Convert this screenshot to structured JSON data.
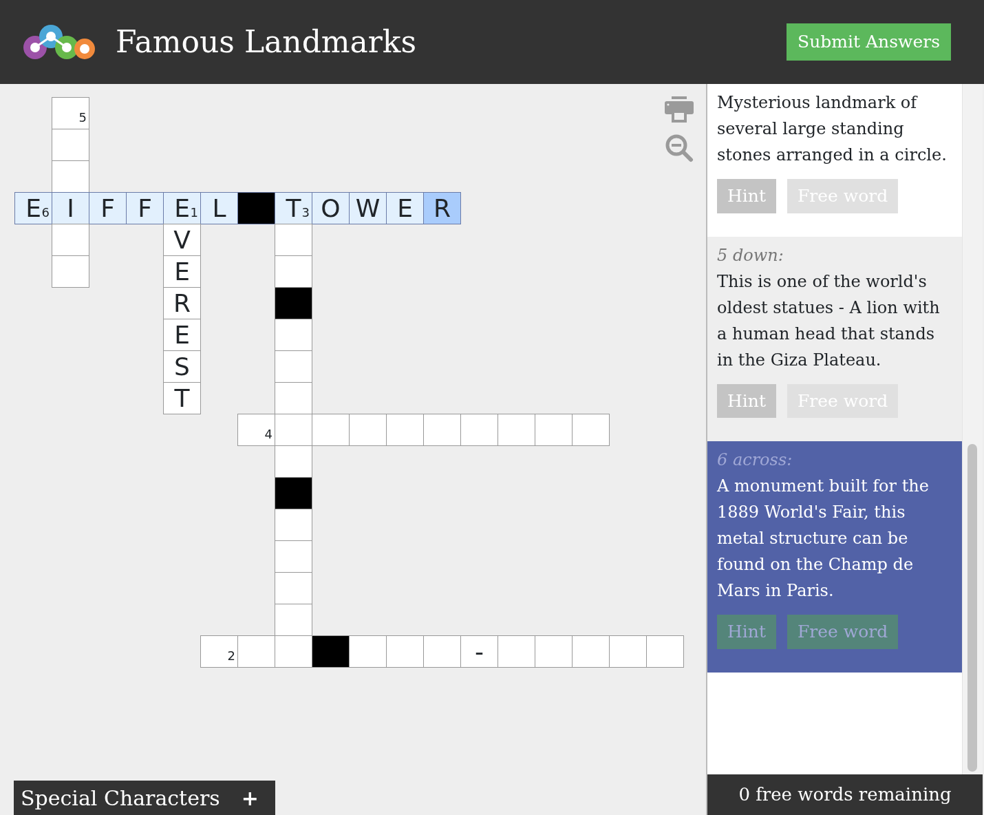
{
  "header": {
    "title": "Famous Landmarks",
    "submit_button": "Submit Answers"
  },
  "grid": [
    [
      {
        "kind": "none"
      },
      {
        "kind": "open",
        "number": "5",
        "highlighted": false,
        "selected": false
      }
    ],
    [
      {
        "kind": "none"
      },
      {
        "kind": "open",
        "highlighted": false,
        "selected": false
      }
    ],
    [
      {
        "kind": "none"
      },
      {
        "kind": "open",
        "highlighted": false,
        "selected": false
      }
    ],
    [
      {
        "kind": "open",
        "letter": "E",
        "number": "6",
        "highlighted": true,
        "selected": false
      },
      {
        "kind": "open",
        "letter": "I",
        "highlighted": true,
        "selected": false
      },
      {
        "kind": "open",
        "letter": "F",
        "highlighted": true,
        "selected": false
      },
      {
        "kind": "open",
        "letter": "F",
        "highlighted": true,
        "selected": false
      },
      {
        "kind": "open",
        "letter": "E",
        "number": "1",
        "highlighted": true,
        "selected": false
      },
      {
        "kind": "open",
        "letter": "L",
        "highlighted": true,
        "selected": false
      },
      {
        "kind": "block",
        "highlighted": true
      },
      {
        "kind": "open",
        "letter": "T",
        "number": "3",
        "highlighted": true,
        "selected": false
      },
      {
        "kind": "open",
        "letter": "O",
        "highlighted": true,
        "selected": false
      },
      {
        "kind": "open",
        "letter": "W",
        "highlighted": true,
        "selected": false
      },
      {
        "kind": "open",
        "letter": "E",
        "highlighted": true,
        "selected": false
      },
      {
        "kind": "open",
        "letter": "R",
        "highlighted": true,
        "selected": true
      }
    ],
    [
      {
        "kind": "none"
      },
      {
        "kind": "open",
        "highlighted": false,
        "selected": false
      },
      {
        "kind": "none"
      },
      {
        "kind": "none"
      },
      {
        "kind": "open",
        "letter": "V",
        "highlighted": false,
        "selected": false
      },
      {
        "kind": "none"
      },
      {
        "kind": "none"
      },
      {
        "kind": "open",
        "highlighted": false,
        "selected": false
      }
    ],
    [
      {
        "kind": "none"
      },
      {
        "kind": "open",
        "highlighted": false,
        "selected": false
      },
      {
        "kind": "none"
      },
      {
        "kind": "none"
      },
      {
        "kind": "open",
        "letter": "E",
        "highlighted": false,
        "selected": false
      },
      {
        "kind": "none"
      },
      {
        "kind": "none"
      },
      {
        "kind": "open",
        "highlighted": false,
        "selected": false
      }
    ],
    [
      {
        "kind": "none"
      },
      {
        "kind": "none"
      },
      {
        "kind": "none"
      },
      {
        "kind": "none"
      },
      {
        "kind": "open",
        "letter": "R",
        "highlighted": false,
        "selected": false
      },
      {
        "kind": "none"
      },
      {
        "kind": "none"
      },
      {
        "kind": "block",
        "highlighted": false
      }
    ],
    [
      {
        "kind": "none"
      },
      {
        "kind": "none"
      },
      {
        "kind": "none"
      },
      {
        "kind": "none"
      },
      {
        "kind": "open",
        "letter": "E",
        "highlighted": false,
        "selected": false
      },
      {
        "kind": "none"
      },
      {
        "kind": "none"
      },
      {
        "kind": "open",
        "highlighted": false,
        "selected": false
      }
    ],
    [
      {
        "kind": "none"
      },
      {
        "kind": "none"
      },
      {
        "kind": "none"
      },
      {
        "kind": "none"
      },
      {
        "kind": "open",
        "letter": "S",
        "highlighted": false,
        "selected": false
      },
      {
        "kind": "none"
      },
      {
        "kind": "none"
      },
      {
        "kind": "open",
        "highlighted": false,
        "selected": false
      }
    ],
    [
      {
        "kind": "none"
      },
      {
        "kind": "none"
      },
      {
        "kind": "none"
      },
      {
        "kind": "none"
      },
      {
        "kind": "open",
        "letter": "T",
        "highlighted": false,
        "selected": false
      },
      {
        "kind": "none"
      },
      {
        "kind": "none"
      },
      {
        "kind": "open",
        "highlighted": false,
        "selected": false
      }
    ],
    [
      {
        "kind": "none"
      },
      {
        "kind": "none"
      },
      {
        "kind": "none"
      },
      {
        "kind": "none"
      },
      {
        "kind": "none"
      },
      {
        "kind": "none"
      },
      {
        "kind": "open",
        "number": "4",
        "highlighted": false,
        "selected": false
      },
      {
        "kind": "open",
        "highlighted": false,
        "selected": false
      },
      {
        "kind": "open",
        "highlighted": false,
        "selected": false
      },
      {
        "kind": "open",
        "highlighted": false,
        "selected": false
      },
      {
        "kind": "open",
        "highlighted": false,
        "selected": false
      },
      {
        "kind": "open",
        "highlighted": false,
        "selected": false
      },
      {
        "kind": "open",
        "highlighted": false,
        "selected": false
      },
      {
        "kind": "open",
        "highlighted": false,
        "selected": false
      },
      {
        "kind": "open",
        "highlighted": false,
        "selected": false
      },
      {
        "kind": "open",
        "highlighted": false,
        "selected": false
      }
    ],
    [
      {
        "kind": "none"
      },
      {
        "kind": "none"
      },
      {
        "kind": "none"
      },
      {
        "kind": "none"
      },
      {
        "kind": "none"
      },
      {
        "kind": "none"
      },
      {
        "kind": "none"
      },
      {
        "kind": "open",
        "highlighted": false,
        "selected": false
      }
    ],
    [
      {
        "kind": "none"
      },
      {
        "kind": "none"
      },
      {
        "kind": "none"
      },
      {
        "kind": "none"
      },
      {
        "kind": "none"
      },
      {
        "kind": "none"
      },
      {
        "kind": "none"
      },
      {
        "kind": "block",
        "highlighted": false
      }
    ],
    [
      {
        "kind": "none"
      },
      {
        "kind": "none"
      },
      {
        "kind": "none"
      },
      {
        "kind": "none"
      },
      {
        "kind": "none"
      },
      {
        "kind": "none"
      },
      {
        "kind": "none"
      },
      {
        "kind": "open",
        "highlighted": false,
        "selected": false
      }
    ],
    [
      {
        "kind": "none"
      },
      {
        "kind": "none"
      },
      {
        "kind": "none"
      },
      {
        "kind": "none"
      },
      {
        "kind": "none"
      },
      {
        "kind": "none"
      },
      {
        "kind": "none"
      },
      {
        "kind": "open",
        "highlighted": false,
        "selected": false
      }
    ],
    [
      {
        "kind": "none"
      },
      {
        "kind": "none"
      },
      {
        "kind": "none"
      },
      {
        "kind": "none"
      },
      {
        "kind": "none"
      },
      {
        "kind": "none"
      },
      {
        "kind": "none"
      },
      {
        "kind": "open",
        "highlighted": false,
        "selected": false
      }
    ],
    [
      {
        "kind": "none"
      },
      {
        "kind": "none"
      },
      {
        "kind": "none"
      },
      {
        "kind": "none"
      },
      {
        "kind": "none"
      },
      {
        "kind": "none"
      },
      {
        "kind": "none"
      },
      {
        "kind": "open",
        "highlighted": false,
        "selected": false
      }
    ],
    [
      {
        "kind": "none"
      },
      {
        "kind": "none"
      },
      {
        "kind": "none"
      },
      {
        "kind": "none"
      },
      {
        "kind": "none"
      },
      {
        "kind": "open",
        "number": "2",
        "highlighted": false,
        "selected": false
      },
      {
        "kind": "open",
        "highlighted": false,
        "selected": false
      },
      {
        "kind": "open",
        "highlighted": false,
        "selected": false
      },
      {
        "kind": "block",
        "highlighted": false
      },
      {
        "kind": "open",
        "highlighted": false,
        "selected": false
      },
      {
        "kind": "open",
        "highlighted": false,
        "selected": false
      },
      {
        "kind": "open",
        "highlighted": false,
        "selected": false
      },
      {
        "kind": "open",
        "letter": "-",
        "highlighted": false,
        "selected": false
      },
      {
        "kind": "open",
        "highlighted": false,
        "selected": false
      },
      {
        "kind": "open",
        "highlighted": false,
        "selected": false
      },
      {
        "kind": "open",
        "highlighted": false,
        "selected": false
      },
      {
        "kind": "open",
        "highlighted": false,
        "selected": false
      },
      {
        "kind": "open",
        "highlighted": false,
        "selected": false
      }
    ]
  ],
  "special_characters": {
    "label": "Special Characters",
    "toggle": "+"
  },
  "clues": [
    {
      "text": "Mysterious landmark of several large standing stones arranged in a circle.",
      "selected": false,
      "buttons": [
        {
          "kind": "hint",
          "label": "Hint"
        },
        {
          "kind": "free-word",
          "label": "Free word"
        }
      ]
    },
    {
      "label": "5 down:",
      "text": "This is one of the world's oldest statues - A lion with a human head that stands in the Giza Plateau.",
      "selected": false,
      "buttons": [
        {
          "kind": "hint",
          "label": "Hint"
        },
        {
          "kind": "free-word",
          "label": "Free word"
        }
      ]
    },
    {
      "label": "6 across:",
      "text": "A monument built for the 1889 World's Fair, this metal structure can be found on the Champ de Mars in Paris.",
      "selected": true,
      "buttons": [
        {
          "kind": "hint",
          "label": "Hint"
        },
        {
          "kind": "free-word",
          "label": "Free word"
        }
      ]
    }
  ],
  "status_bar": "0 free words remaining"
}
